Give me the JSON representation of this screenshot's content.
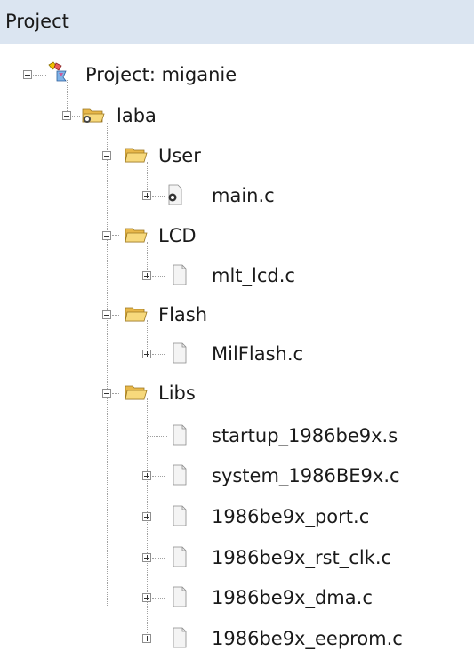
{
  "header": {
    "title": "Project"
  },
  "tree": {
    "project": "Project: miganie",
    "target": "laba",
    "groups": {
      "user": {
        "label": "User",
        "files": [
          "main.c"
        ]
      },
      "lcd": {
        "label": "LCD",
        "files": [
          "mlt_lcd.c"
        ]
      },
      "flash": {
        "label": "Flash",
        "files": [
          "MilFlash.c"
        ]
      },
      "libs": {
        "label": "Libs",
        "files": [
          "startup_1986be9x.s",
          "system_1986BE9x.c",
          "1986be9x_port.c",
          "1986be9x_rst_clk.c",
          "1986be9x_dma.c",
          "1986be9x_eeprom.c"
        ]
      }
    }
  },
  "icons": [
    "project-icon",
    "target-folder-icon",
    "folder-icon",
    "c-file-icon",
    "file-icon"
  ]
}
